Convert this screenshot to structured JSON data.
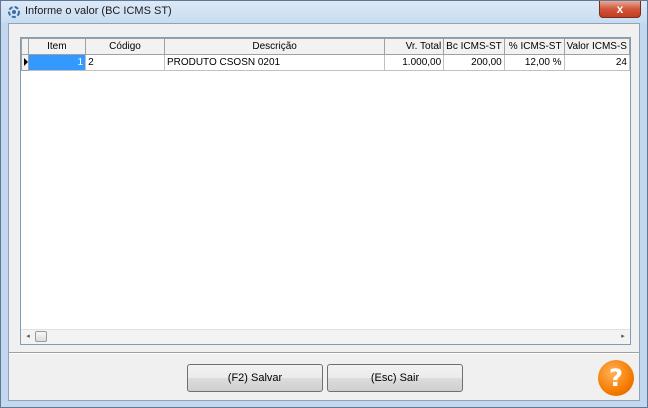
{
  "window": {
    "title": "Informe o valor (BC ICMS ST)",
    "close_label": "x"
  },
  "grid": {
    "columns": [
      "Item",
      "Código",
      "Descrição",
      "Vr. Total",
      "Bc ICMS-ST",
      "% ICMS-ST",
      "Valor ICMS-S"
    ],
    "rows": [
      {
        "item": "1",
        "codigo": "2",
        "descricao": "PRODUTO CSOSN 0201",
        "vr_total": "1.000,00",
        "bc_icms_st": "200,00",
        "pct_icms_st": "12,00 %",
        "valor_icms_st": "24"
      }
    ],
    "scroll_left": "◂",
    "scroll_right": "▸"
  },
  "buttons": {
    "save": "(F2) Salvar",
    "exit": "(Esc) Sair"
  },
  "help": {
    "icon": "question-icon",
    "glyph": "?"
  },
  "colors": {
    "selection": "#3399ff",
    "help_orange": "#f57c00",
    "close_red": "#c23e20"
  }
}
